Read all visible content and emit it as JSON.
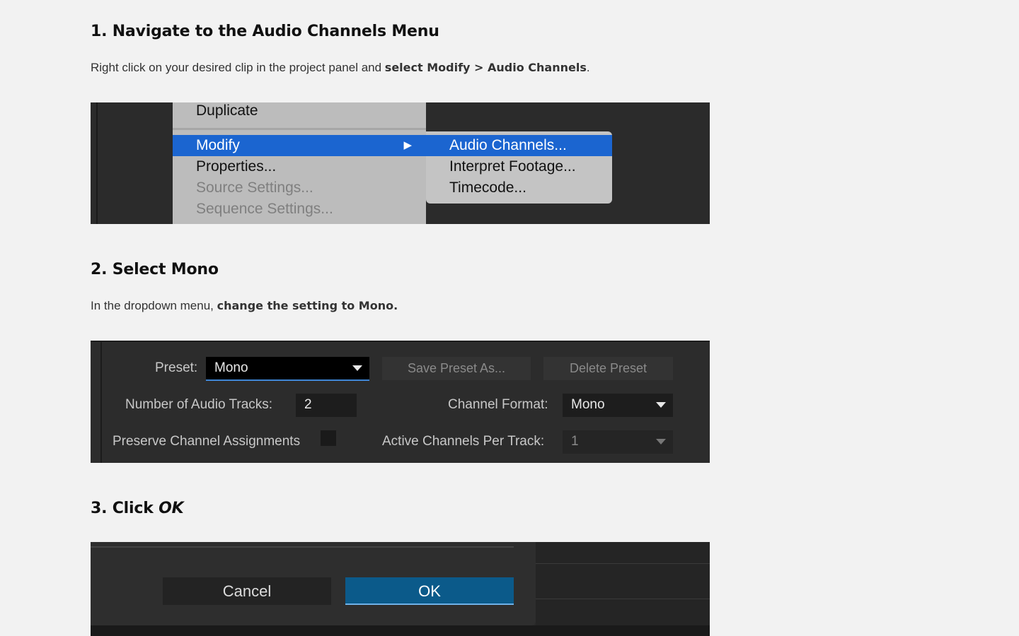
{
  "steps": [
    {
      "heading": "1. Navigate to the Audio Channels Menu",
      "text_before": "Right click on your desired clip in the project panel and ",
      "text_bold": "select Modify > Audio Channels",
      "text_after": "."
    },
    {
      "heading": "2. Select Mono",
      "text_before": "In the dropdown menu, ",
      "text_bold": "change the setting to Mono.",
      "text_after": ""
    },
    {
      "heading_prefix": "3. Click ",
      "heading_italic": "OK"
    }
  ],
  "context_menu": {
    "items": [
      {
        "label": "Duplicate",
        "state": "normal"
      },
      {
        "label": "Modify",
        "state": "selected",
        "submenu_arrow": "▶"
      },
      {
        "label": "Properties...",
        "state": "normal"
      },
      {
        "label": "Source Settings...",
        "state": "disabled"
      },
      {
        "label": "Sequence Settings...",
        "state": "disabled"
      }
    ],
    "submenu": [
      {
        "label": "Audio Channels...",
        "state": "selected"
      },
      {
        "label": "Interpret Footage...",
        "state": "normal"
      },
      {
        "label": "Timecode...",
        "state": "normal"
      }
    ],
    "selection_color": "#1b65d0"
  },
  "audio_dialog": {
    "preset_label": "Preset:",
    "preset_value": "Mono",
    "save_preset": "Save Preset As...",
    "delete_preset": "Delete Preset",
    "tracks_label": "Number of Audio Tracks:",
    "tracks_value": "2",
    "format_label": "Channel Format:",
    "format_value": "Mono",
    "preserve_label": "Preserve Channel Assignments",
    "active_label": "Active Channels Per Track:",
    "active_value": "1"
  },
  "ok_dialog": {
    "cancel_label": "Cancel",
    "ok_label": "OK",
    "ok_color": "#0b5a8a"
  }
}
